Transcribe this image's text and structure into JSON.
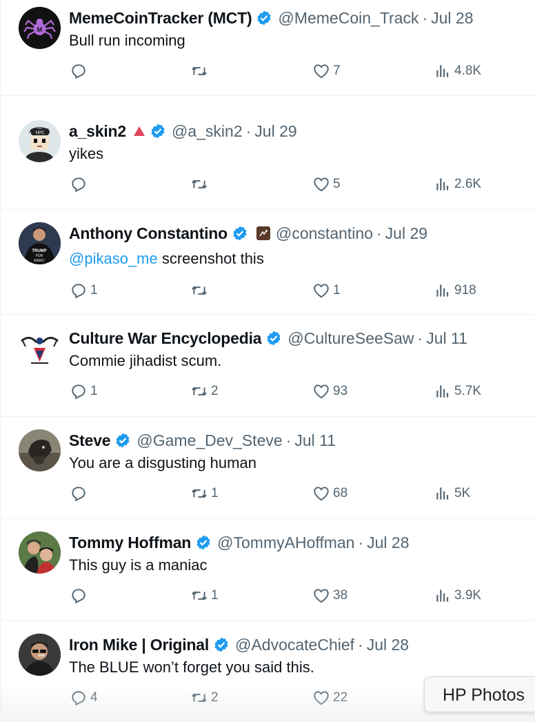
{
  "tweets": [
    {
      "name": "MemeCoinTracker (MCT)",
      "handle": "@MemeCoin_Track",
      "date": "Jul 28",
      "text": "Bull run incoming",
      "mention": "",
      "replies": "",
      "retweets": "",
      "likes": "7",
      "views": "4.8K",
      "avatar": "spider-logo-avatar",
      "badge": ""
    },
    {
      "name": "a_skin2",
      "handle": "@a_skin2",
      "date": "Jul 29",
      "text": "yikes",
      "mention": "",
      "replies": "",
      "retweets": "",
      "likes": "5",
      "views": "2.6K",
      "avatar": "cartoon-npc-avatar",
      "badge": "red-triangle-icon"
    },
    {
      "name": "Anthony Constantino",
      "handle": "@constantino",
      "date": "Jul 29",
      "text": "screenshot this",
      "mention": "@pikaso_me",
      "replies": "1",
      "retweets": "",
      "likes": "1",
      "views": "918",
      "avatar": "person-trump-shirt-avatar",
      "badge": "brown-square-icon"
    },
    {
      "name": "Culture War Encyclopedia",
      "handle": "@CultureSeeSaw",
      "date": "Jul 11",
      "text": "Commie jihadist scum.",
      "mention": "",
      "replies": "1",
      "retweets": "2",
      "likes": "93",
      "views": "5.7K",
      "avatar": "emblem-avatar",
      "badge": ""
    },
    {
      "name": "Steve",
      "handle": "@Game_Dev_Steve",
      "date": "Jul 11",
      "text": "You are a disgusting human",
      "mention": "",
      "replies": "",
      "retweets": "1",
      "likes": "68",
      "views": "5K",
      "avatar": "goat-avatar",
      "badge": ""
    },
    {
      "name": "Tommy Hoffman",
      "handle": "@TommyAHoffman",
      "date": "Jul 28",
      "text": "This guy is a maniac",
      "mention": "",
      "replies": "",
      "retweets": "1",
      "likes": "38",
      "views": "3.9K",
      "avatar": "two-people-avatar",
      "badge": ""
    },
    {
      "name": "Iron Mike | Original",
      "handle": "@AdvocateChief",
      "date": "Jul 28",
      "text": "The BLUE won’t forget you said this.",
      "mention": "",
      "replies": "4",
      "retweets": "2",
      "likes": "22",
      "views": "",
      "avatar": "man-sunglasses-avatar",
      "badge": ""
    }
  ],
  "separator": "·",
  "popup": {
    "label": "HP Photos"
  },
  "colors": {
    "verified": "#1d9bf0",
    "mention": "#1d9bf0",
    "muted": "#536471",
    "text": "#0f1419"
  },
  "icons": {
    "reply": "reply-icon",
    "retweet": "retweet-icon",
    "like": "heart-icon",
    "views": "views-bar-chart-icon",
    "verified": "verified-badge-icon"
  }
}
